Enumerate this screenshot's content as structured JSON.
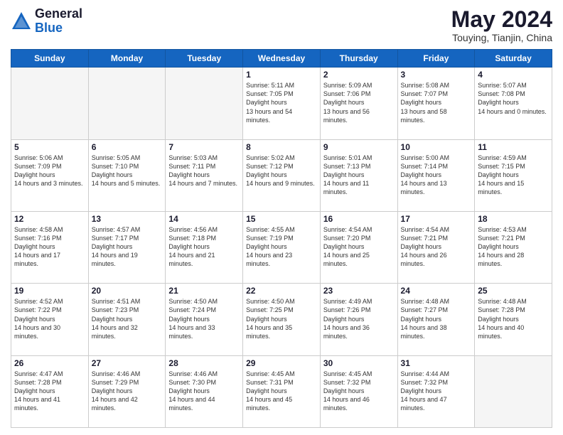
{
  "header": {
    "logo_general": "General",
    "logo_blue": "Blue",
    "month_title": "May 2024",
    "location": "Touying, Tianjin, China"
  },
  "weekdays": [
    "Sunday",
    "Monday",
    "Tuesday",
    "Wednesday",
    "Thursday",
    "Friday",
    "Saturday"
  ],
  "weeks": [
    [
      {
        "day": "",
        "empty": true
      },
      {
        "day": "",
        "empty": true
      },
      {
        "day": "",
        "empty": true
      },
      {
        "day": "1",
        "sunrise": "5:11 AM",
        "sunset": "7:05 PM",
        "daylight": "13 hours and 54 minutes."
      },
      {
        "day": "2",
        "sunrise": "5:09 AM",
        "sunset": "7:06 PM",
        "daylight": "13 hours and 56 minutes."
      },
      {
        "day": "3",
        "sunrise": "5:08 AM",
        "sunset": "7:07 PM",
        "daylight": "13 hours and 58 minutes."
      },
      {
        "day": "4",
        "sunrise": "5:07 AM",
        "sunset": "7:08 PM",
        "daylight": "14 hours and 0 minutes."
      }
    ],
    [
      {
        "day": "5",
        "sunrise": "5:06 AM",
        "sunset": "7:09 PM",
        "daylight": "14 hours and 3 minutes."
      },
      {
        "day": "6",
        "sunrise": "5:05 AM",
        "sunset": "7:10 PM",
        "daylight": "14 hours and 5 minutes."
      },
      {
        "day": "7",
        "sunrise": "5:03 AM",
        "sunset": "7:11 PM",
        "daylight": "14 hours and 7 minutes."
      },
      {
        "day": "8",
        "sunrise": "5:02 AM",
        "sunset": "7:12 PM",
        "daylight": "14 hours and 9 minutes."
      },
      {
        "day": "9",
        "sunrise": "5:01 AM",
        "sunset": "7:13 PM",
        "daylight": "14 hours and 11 minutes."
      },
      {
        "day": "10",
        "sunrise": "5:00 AM",
        "sunset": "7:14 PM",
        "daylight": "14 hours and 13 minutes."
      },
      {
        "day": "11",
        "sunrise": "4:59 AM",
        "sunset": "7:15 PM",
        "daylight": "14 hours and 15 minutes."
      }
    ],
    [
      {
        "day": "12",
        "sunrise": "4:58 AM",
        "sunset": "7:16 PM",
        "daylight": "14 hours and 17 minutes."
      },
      {
        "day": "13",
        "sunrise": "4:57 AM",
        "sunset": "7:17 PM",
        "daylight": "14 hours and 19 minutes."
      },
      {
        "day": "14",
        "sunrise": "4:56 AM",
        "sunset": "7:18 PM",
        "daylight": "14 hours and 21 minutes."
      },
      {
        "day": "15",
        "sunrise": "4:55 AM",
        "sunset": "7:19 PM",
        "daylight": "14 hours and 23 minutes."
      },
      {
        "day": "16",
        "sunrise": "4:54 AM",
        "sunset": "7:20 PM",
        "daylight": "14 hours and 25 minutes."
      },
      {
        "day": "17",
        "sunrise": "4:54 AM",
        "sunset": "7:21 PM",
        "daylight": "14 hours and 26 minutes."
      },
      {
        "day": "18",
        "sunrise": "4:53 AM",
        "sunset": "7:21 PM",
        "daylight": "14 hours and 28 minutes."
      }
    ],
    [
      {
        "day": "19",
        "sunrise": "4:52 AM",
        "sunset": "7:22 PM",
        "daylight": "14 hours and 30 minutes."
      },
      {
        "day": "20",
        "sunrise": "4:51 AM",
        "sunset": "7:23 PM",
        "daylight": "14 hours and 32 minutes."
      },
      {
        "day": "21",
        "sunrise": "4:50 AM",
        "sunset": "7:24 PM",
        "daylight": "14 hours and 33 minutes."
      },
      {
        "day": "22",
        "sunrise": "4:50 AM",
        "sunset": "7:25 PM",
        "daylight": "14 hours and 35 minutes."
      },
      {
        "day": "23",
        "sunrise": "4:49 AM",
        "sunset": "7:26 PM",
        "daylight": "14 hours and 36 minutes."
      },
      {
        "day": "24",
        "sunrise": "4:48 AM",
        "sunset": "7:27 PM",
        "daylight": "14 hours and 38 minutes."
      },
      {
        "day": "25",
        "sunrise": "4:48 AM",
        "sunset": "7:28 PM",
        "daylight": "14 hours and 40 minutes."
      }
    ],
    [
      {
        "day": "26",
        "sunrise": "4:47 AM",
        "sunset": "7:28 PM",
        "daylight": "14 hours and 41 minutes."
      },
      {
        "day": "27",
        "sunrise": "4:46 AM",
        "sunset": "7:29 PM",
        "daylight": "14 hours and 42 minutes."
      },
      {
        "day": "28",
        "sunrise": "4:46 AM",
        "sunset": "7:30 PM",
        "daylight": "14 hours and 44 minutes."
      },
      {
        "day": "29",
        "sunrise": "4:45 AM",
        "sunset": "7:31 PM",
        "daylight": "14 hours and 45 minutes."
      },
      {
        "day": "30",
        "sunrise": "4:45 AM",
        "sunset": "7:32 PM",
        "daylight": "14 hours and 46 minutes."
      },
      {
        "day": "31",
        "sunrise": "4:44 AM",
        "sunset": "7:32 PM",
        "daylight": "14 hours and 47 minutes."
      },
      {
        "day": "",
        "empty": true
      }
    ]
  ]
}
